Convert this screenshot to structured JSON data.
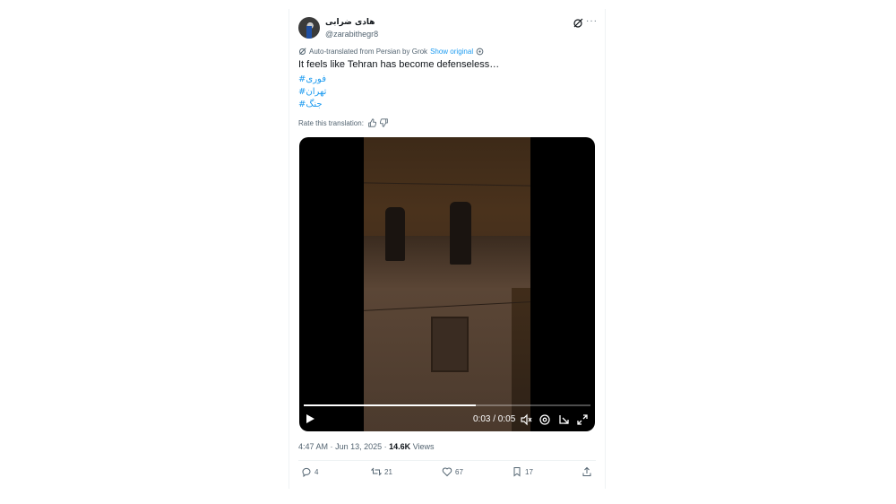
{
  "author": {
    "display_name": "هادی ضرابی",
    "handle": "@zarabithegr8",
    "avatar_icon": "profile-avatar"
  },
  "header_icons": [
    "grok-icon",
    "more-icon"
  ],
  "more_label": "···",
  "translation": {
    "note": "Auto-translated from Persian by Grok",
    "show_original": "Show original",
    "rate_label": "Rate this translation:"
  },
  "text": "It feels like Tehran has become defenseless…",
  "hashtags": [
    "#فوری",
    "#تهران",
    "#جنگ"
  ],
  "video": {
    "time_display": "0:03 / 0:05",
    "progress_fraction": 0.6,
    "controls": [
      "play-icon",
      "mute-icon",
      "settings-icon",
      "pip-icon",
      "fullscreen-icon"
    ]
  },
  "meta": {
    "time": "4:47 AM",
    "date": "Jun 13, 2025",
    "views_count": "14.6K",
    "views_label": "Views",
    "separator": "·"
  },
  "actions": {
    "replies": "4",
    "reposts": "21",
    "likes": "67",
    "bookmarks": "17"
  },
  "colors": {
    "accent": "#1d9bf0",
    "text": "#0f1419",
    "muted": "#536471",
    "border": "#eff3f4"
  }
}
